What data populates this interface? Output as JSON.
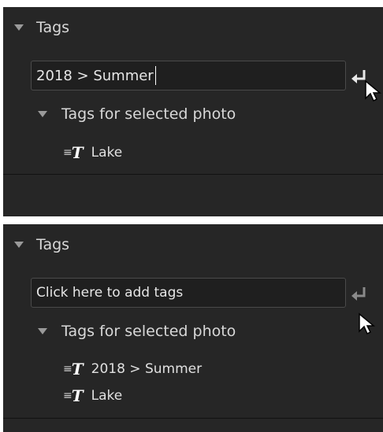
{
  "top": {
    "header": "Tags",
    "input_value": "2018 > Summer",
    "subheader": "Tags for selected photo",
    "tags": [
      "Lake"
    ]
  },
  "bottom": {
    "header": "Tags",
    "input_placeholder": "Click here to add tags",
    "subheader": "Tags for selected photo",
    "tags": [
      "2018 > Summer",
      "Lake"
    ]
  },
  "colors": {
    "panel_bg": "#262626",
    "input_bg": "#1f1f1f",
    "text": "#dcdcdc"
  },
  "icons": [
    "triangle-down-icon",
    "enter-icon",
    "tag-icon",
    "mouse-cursor-icon"
  ]
}
